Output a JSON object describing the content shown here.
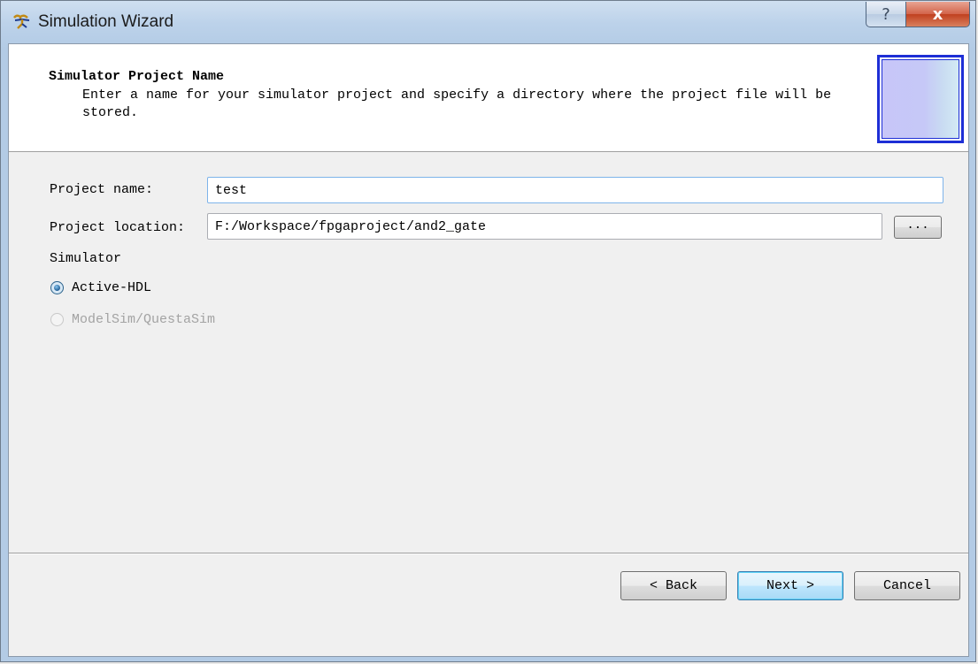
{
  "window": {
    "title": "Simulation Wizard",
    "icon": "wizard-app-icon",
    "help_glyph": "?",
    "close_glyph": "x"
  },
  "header": {
    "title": "Simulator Project Name",
    "description": "Enter a name for your simulator project and specify a directory where the project file will be stored."
  },
  "form": {
    "project_name_label": "Project name:",
    "project_name_value": "test",
    "project_location_label": "Project location:",
    "project_location_value": "F:/Workspace/fpgaproject/and2_gate",
    "browse_label": "...",
    "simulator_label": "Simulator",
    "simulators": [
      {
        "label": "Active-HDL",
        "selected": true,
        "enabled": true
      },
      {
        "label": "ModelSim/QuestaSim",
        "selected": false,
        "enabled": false
      }
    ]
  },
  "buttons": {
    "back": "< Back",
    "next": "Next >",
    "cancel": "Cancel"
  },
  "colors": {
    "accent": "#1e2fd6",
    "default_button": "#3c7fb1",
    "close_button": "#c0401f"
  }
}
